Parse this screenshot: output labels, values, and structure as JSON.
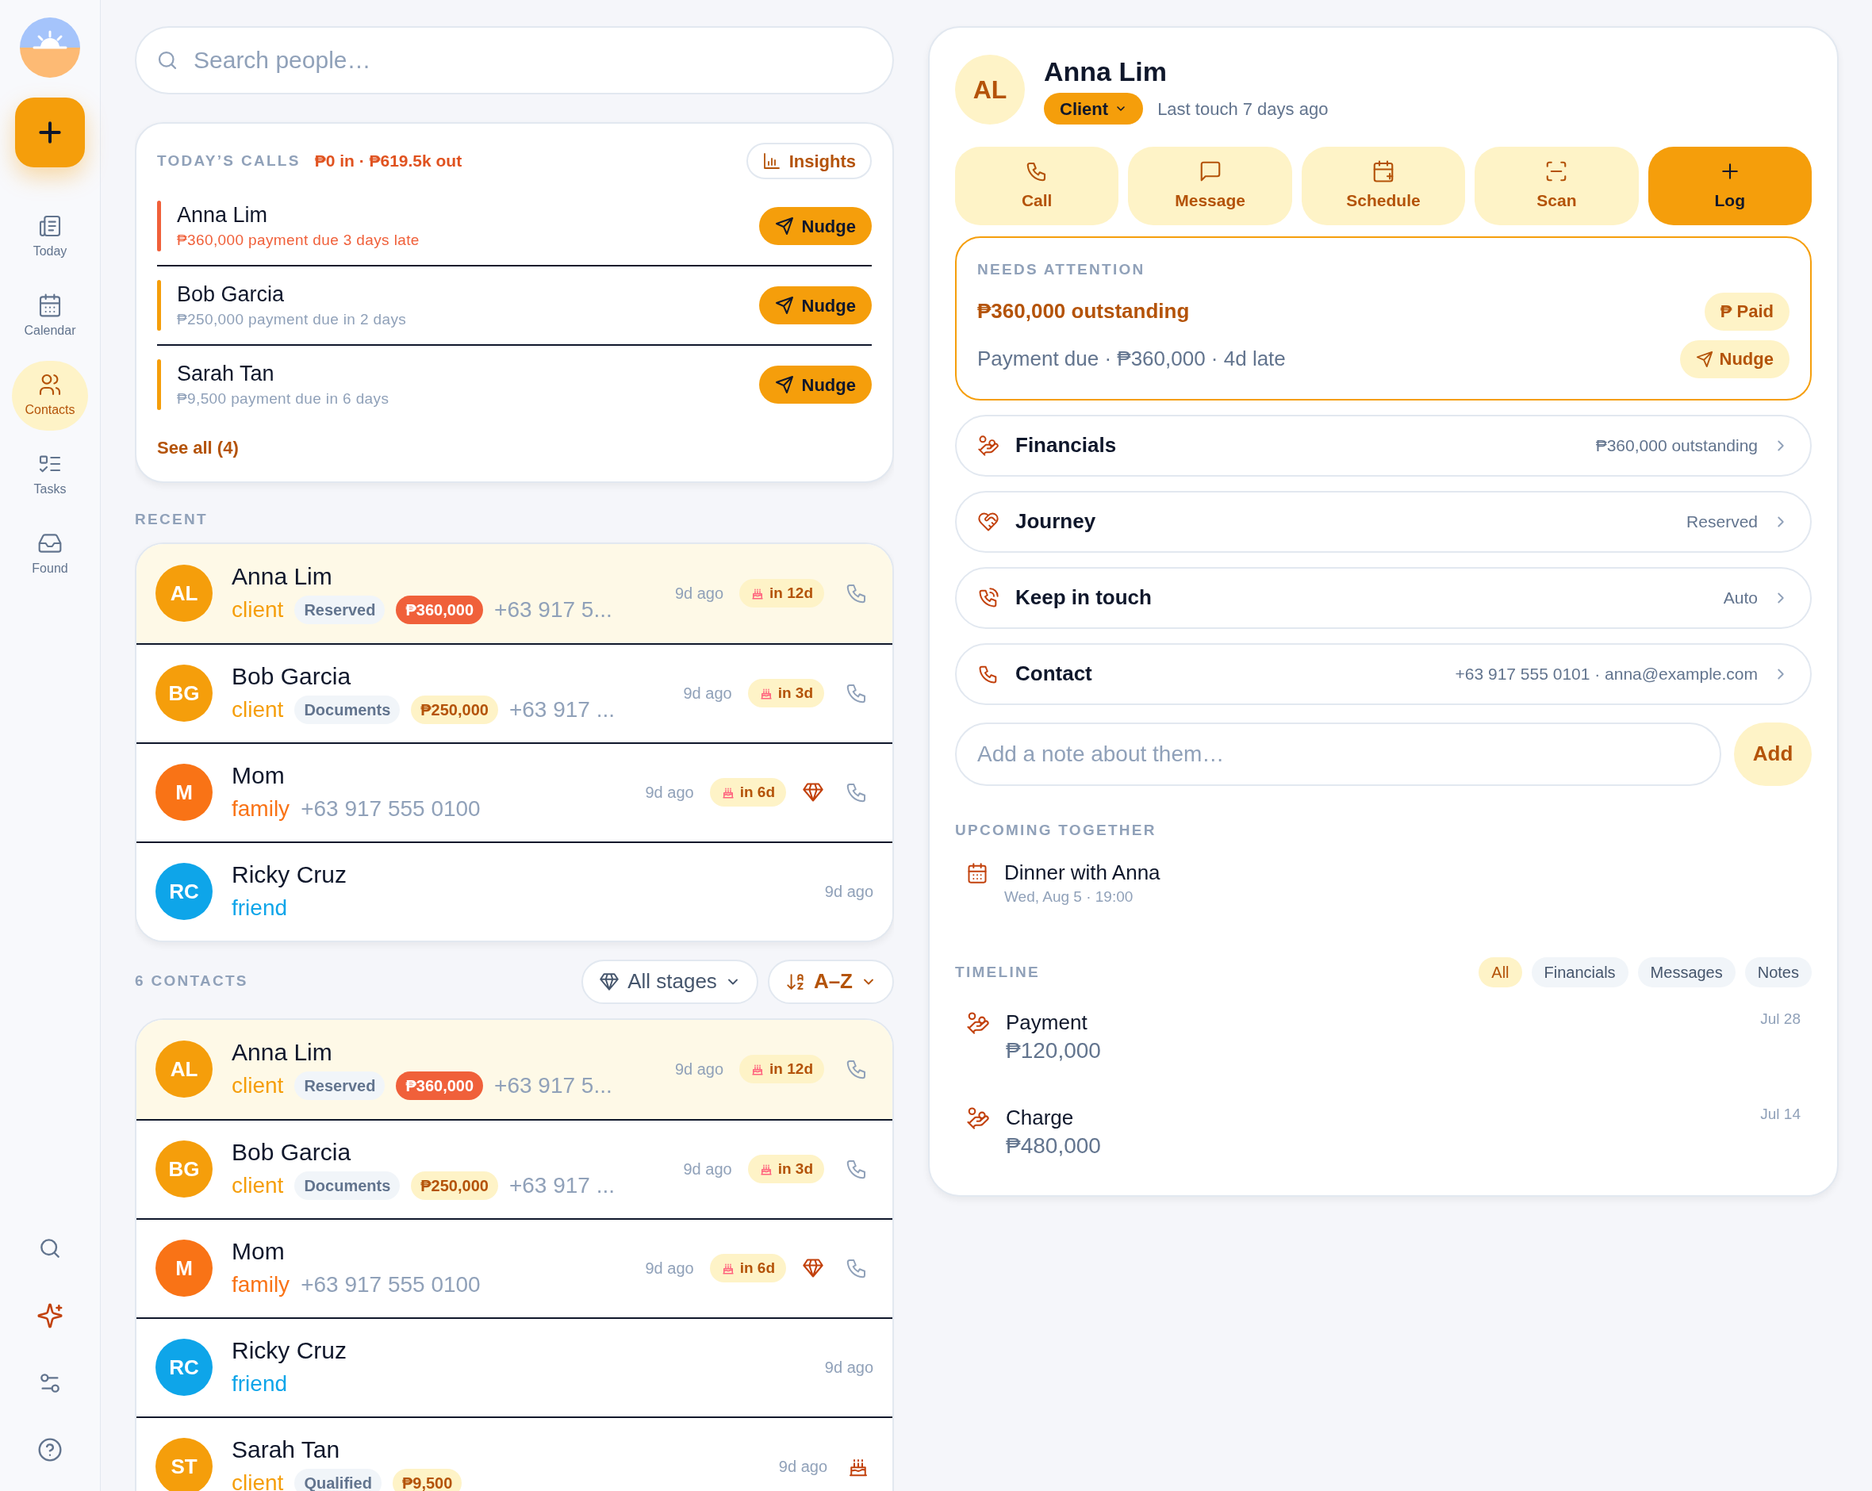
{
  "sidebar": {
    "nav": [
      {
        "label": "Today",
        "kind": "today",
        "selected": false
      },
      {
        "label": "Calendar",
        "kind": "calendar",
        "selected": false
      },
      {
        "label": "Contacts",
        "kind": "contacts",
        "selected": true
      },
      {
        "label": "Tasks",
        "kind": "tasks",
        "selected": false
      },
      {
        "label": "Found",
        "kind": "found",
        "selected": false
      }
    ]
  },
  "search": {
    "placeholder": "Search people…"
  },
  "todays_calls": {
    "title": "TODAY’S CALLS",
    "summary": "₱0 in · ₱619.5k out",
    "insights": "Insights",
    "items": [
      {
        "name": "Anna Lim",
        "detail": "₱360,000 payment due 3 days late",
        "late": true,
        "action": "Nudge"
      },
      {
        "name": "Bob Garcia",
        "detail": "₱250,000 payment due in 2 days",
        "late": false,
        "action": "Nudge"
      },
      {
        "name": "Sarah Tan",
        "detail": "₱9,500 payment due in 6 days",
        "late": false,
        "action": "Nudge"
      }
    ],
    "see_all": "See all (4)"
  },
  "recent": {
    "title": "RECENT",
    "contacts": [
      {
        "initials": "AL",
        "name": "Anna Lim",
        "relation": "client",
        "color": "#f59e0b",
        "stage": "Reserved",
        "amount": "₱360,000",
        "overdue": true,
        "phone": "+63 917 5...",
        "last": "9d ago",
        "birthday": "in 12d",
        "vip": false,
        "callable": true,
        "birthday_marker": false,
        "selected": true
      },
      {
        "initials": "BG",
        "name": "Bob Garcia",
        "relation": "client",
        "color": "#f59e0b",
        "stage": "Documents",
        "amount": "₱250,000",
        "overdue": false,
        "phone": "+63 917 ...",
        "last": "9d ago",
        "birthday": "in 3d",
        "vip": false,
        "callable": true,
        "birthday_marker": false,
        "selected": false
      },
      {
        "initials": "M",
        "name": "Mom",
        "relation": "family",
        "color": "#f97316",
        "phone": "+63 917 555 0100",
        "last": "9d ago",
        "birthday": "in 6d",
        "vip": true,
        "callable": true,
        "birthday_marker": false,
        "selected": false
      },
      {
        "initials": "RC",
        "name": "Ricky Cruz",
        "relation": "friend",
        "color": "#0ea5e9",
        "last": "9d ago",
        "vip": false,
        "callable": false,
        "birthday_marker": false,
        "selected": false
      }
    ]
  },
  "contacts": {
    "title": "6 CONTACTS",
    "stage_filter": "All stages",
    "sort": "A–Z",
    "contacts": [
      {
        "initials": "AL",
        "name": "Anna Lim",
        "relation": "client",
        "color": "#f59e0b",
        "stage": "Reserved",
        "amount": "₱360,000",
        "overdue": true,
        "phone": "+63 917 5...",
        "last": "9d ago",
        "birthday": "in 12d",
        "vip": false,
        "callable": true,
        "birthday_marker": false,
        "selected": true
      },
      {
        "initials": "BG",
        "name": "Bob Garcia",
        "relation": "client",
        "color": "#f59e0b",
        "stage": "Documents",
        "amount": "₱250,000",
        "overdue": false,
        "phone": "+63 917 ...",
        "last": "9d ago",
        "birthday": "in 3d",
        "vip": false,
        "callable": true,
        "birthday_marker": false,
        "selected": false
      },
      {
        "initials": "M",
        "name": "Mom",
        "relation": "family",
        "color": "#f97316",
        "phone": "+63 917 555 0100",
        "last": "9d ago",
        "birthday": "in 6d",
        "vip": true,
        "callable": true,
        "birthday_marker": false,
        "selected": false
      },
      {
        "initials": "RC",
        "name": "Ricky Cruz",
        "relation": "friend",
        "color": "#0ea5e9",
        "last": "9d ago",
        "vip": false,
        "callable": false,
        "birthday_marker": false,
        "selected": false
      },
      {
        "initials": "ST",
        "name": "Sarah Tan",
        "relation": "client",
        "color": "#f59e0b",
        "stage": "Qualified",
        "amount": "₱9,500",
        "overdue": false,
        "last": "9d ago",
        "vip": false,
        "callable": false,
        "birthday_marker": true,
        "selected": false
      }
    ]
  },
  "profile": {
    "initials": "AL",
    "name": "Anna Lim",
    "type": "Client",
    "last_touch": "Last touch 7 days ago",
    "actions": [
      {
        "label": "Call",
        "kind": "call",
        "primary": false
      },
      {
        "label": "Message",
        "kind": "message",
        "primary": false
      },
      {
        "label": "Schedule",
        "kind": "schedule",
        "primary": false
      },
      {
        "label": "Scan",
        "kind": "scan",
        "primary": false
      },
      {
        "label": "Log",
        "kind": "log",
        "primary": true
      }
    ],
    "attention": {
      "title": "NEEDS ATTENTION",
      "headline": "₱360,000 outstanding",
      "detail": "Payment due · ₱360,000 · 4d late",
      "paid": "₱ Paid",
      "nudge": "Nudge"
    },
    "sections": [
      {
        "kind": "financials",
        "label": "Financials",
        "value": "₱360,000 outstanding"
      },
      {
        "kind": "journey",
        "label": "Journey",
        "value": "Reserved"
      },
      {
        "kind": "keep",
        "label": "Keep in touch",
        "value": "Auto"
      },
      {
        "kind": "contact",
        "label": "Contact",
        "value": "+63 917 555 0101 · anna@example.com"
      }
    ],
    "note": {
      "placeholder": "Add a note about them…",
      "button": "Add"
    },
    "upcoming": {
      "title": "UPCOMING TOGETHER",
      "events": [
        {
          "title": "Dinner with Anna",
          "when": "Wed, Aug 5 · 19:00"
        }
      ]
    },
    "timeline": {
      "title": "TIMELINE",
      "filters": [
        {
          "label": "All",
          "selected": true
        },
        {
          "label": "Financials",
          "selected": false
        },
        {
          "label": "Messages",
          "selected": false
        },
        {
          "label": "Notes",
          "selected": false
        }
      ],
      "entries": [
        {
          "title": "Payment",
          "amount": "₱120,000",
          "date": "Jul 28"
        },
        {
          "title": "Charge",
          "amount": "₱480,000",
          "date": "Jul 14"
        }
      ]
    }
  }
}
